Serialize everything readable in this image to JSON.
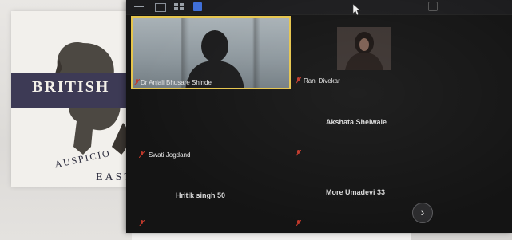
{
  "background_slide": {
    "title": "BRITISH",
    "subtitle": "AUSPICIO",
    "bottom_text": "EAST"
  },
  "meeting": {
    "participants": [
      {
        "name": "Dr Anjali Bhusare Shinde",
        "video": true,
        "active_speaker": true
      },
      {
        "name": "Rani Divekar",
        "video": false,
        "profile_picture": true
      },
      {
        "name": "Akshata Shelwale",
        "video": false
      },
      {
        "name": "Swati Jogdand",
        "video": false
      },
      {
        "name": "Hritik singh 50",
        "video": false
      },
      {
        "name": "More Umadevi 33",
        "video": false
      }
    ],
    "next_page_icon": "chevron-right-icon",
    "colors": {
      "active_speaker_border": "#e6c54d",
      "window_background": "#141414",
      "muted_mic": "#c0392b"
    }
  }
}
